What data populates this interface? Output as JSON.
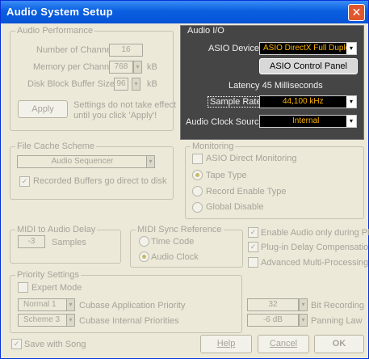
{
  "window": {
    "title": "Audio System Setup",
    "close_glyph": "✕"
  },
  "audio_performance": {
    "label": "Audio Performance",
    "channels_label": "Number of Channels",
    "channels_value": "16",
    "memory_label": "Memory per Channel",
    "memory_value": "768",
    "memory_unit": "kB",
    "buffer_label": "Disk Block Buffer Size",
    "buffer_value": "96",
    "buffer_unit": "kB",
    "apply_label": "Apply",
    "apply_note_line1": "Settings do not take effect",
    "apply_note_line2": "until you click 'Apply'!"
  },
  "audio_io": {
    "label": "Audio I/O",
    "device_label": "ASIO Device",
    "device_value": "ASIO DirectX Full Duplex",
    "control_panel_label": "ASIO Control Panel",
    "latency_text": "Latency 45 Milliseconds",
    "sample_rate_label": "Sample Rate",
    "sample_rate_value": "44,100 kHz",
    "clock_label": "Audio Clock Source",
    "clock_value": "Internal"
  },
  "file_cache": {
    "label": "File Cache Scheme",
    "scheme_value": "Audio Sequencer",
    "recorded_buffers_label": "Recorded Buffers go direct to disk",
    "recorded_buffers_checked": true
  },
  "monitoring": {
    "label": "Monitoring",
    "asio_direct_label": "ASIO Direct Monitoring",
    "options": [
      {
        "label": "Tape Type",
        "selected": true
      },
      {
        "label": "Record Enable Type",
        "selected": false
      },
      {
        "label": "Global Disable",
        "selected": false
      }
    ]
  },
  "midi_audio_delay": {
    "label": "MIDI to Audio Delay",
    "value": "-3",
    "unit": "Samples"
  },
  "midi_sync": {
    "label": "MIDI Sync Reference",
    "options": [
      {
        "label": "Time Code",
        "selected": false
      },
      {
        "label": "Audio Clock",
        "selected": true
      }
    ]
  },
  "options": [
    {
      "label": "Enable Audio only during Play",
      "checked": true
    },
    {
      "label": "Plug-in Delay Compensation",
      "checked": true
    },
    {
      "label": "Advanced Multi-Processing",
      "checked": false
    }
  ],
  "priority": {
    "label": "Priority Settings",
    "expert_label": "Expert Mode",
    "app_priority_value": "Normal 1",
    "app_priority_label": "Cubase Application Priority",
    "internal_value": "Scheme 3",
    "internal_label": "Cubase Internal Priorities"
  },
  "bit_recording": {
    "value": "32",
    "label": "Bit Recording"
  },
  "panning": {
    "value": "-6 dB",
    "label": "Panning Law"
  },
  "footer": {
    "save_label": "Save with Song",
    "save_checked": true,
    "help_label": "Help",
    "cancel_label": "Cancel",
    "ok_label": "OK"
  },
  "icons": {
    "dropdown": "▾",
    "spin_up": "▴",
    "spin_down": "▾",
    "check": "✓"
  }
}
